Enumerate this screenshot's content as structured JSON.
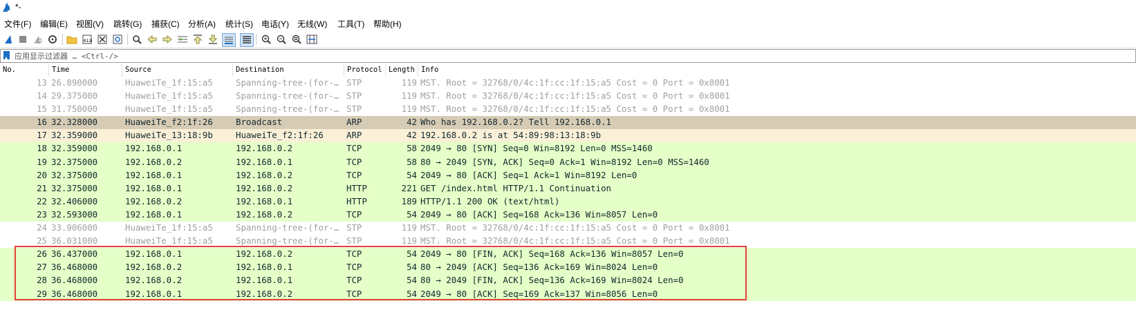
{
  "window": {
    "title": "*-"
  },
  "menu": [
    "文件(F)",
    "编辑(E)",
    "视图(V)",
    "跳转(G)",
    "捕获(C)",
    "分析(A)",
    "统计(S)",
    "电话(Y)",
    "无线(W)",
    "工具(T)",
    "帮助(H)"
  ],
  "toolbar_icons": [
    "shark-fin-start-icon",
    "stop-icon",
    "restart-icon",
    "options-gear-icon",
    "open-folder-icon",
    "save-file-icon",
    "close-file-icon",
    "reload-icon",
    "find-icon",
    "back-arrow-icon",
    "forward-arrow-icon",
    "go-to-packet-icon",
    "first-packet-icon",
    "last-packet-icon",
    "autoscroll-icon",
    "colorize-icon",
    "zoom-in-icon",
    "zoom-out-icon",
    "normal-size-icon",
    "resize-columns-icon"
  ],
  "filter": {
    "placeholder": "应用显示过滤器 … <Ctrl-/>"
  },
  "columns": {
    "no": "No.",
    "time": "Time",
    "source": "Source",
    "destination": "Destination",
    "protocol": "Protocol",
    "length": "Length",
    "info": "Info"
  },
  "packets": [
    {
      "no": "13",
      "time": "26.890000",
      "src": "HuaweiTe_1f:15:a5",
      "dst": "Spanning-tree-(for-…",
      "proto": "STP",
      "len": "119",
      "info": "MST. Root = 32768/0/4c:1f:cc:1f:15:a5  Cost = 0  Port = 0x8001",
      "style": "stp"
    },
    {
      "no": "14",
      "time": "29.375000",
      "src": "HuaweiTe_1f:15:a5",
      "dst": "Spanning-tree-(for-…",
      "proto": "STP",
      "len": "119",
      "info": "MST. Root = 32768/0/4c:1f:cc:1f:15:a5  Cost = 0  Port = 0x8001",
      "style": "stp"
    },
    {
      "no": "15",
      "time": "31.750000",
      "src": "HuaweiTe_1f:15:a5",
      "dst": "Spanning-tree-(for-…",
      "proto": "STP",
      "len": "119",
      "info": "MST. Root = 32768/0/4c:1f:cc:1f:15:a5  Cost = 0  Port = 0x8001",
      "style": "stp"
    },
    {
      "no": "16",
      "time": "32.328000",
      "src": "HuaweiTe_f2:1f:26",
      "dst": "Broadcast",
      "proto": "ARP",
      "len": "42",
      "info": "Who has 192.168.0.2? Tell 192.168.0.1",
      "style": "arp1"
    },
    {
      "no": "17",
      "time": "32.359000",
      "src": "HuaweiTe_13:18:9b",
      "dst": "HuaweiTe_f2:1f:26",
      "proto": "ARP",
      "len": "42",
      "info": "192.168.0.2 is at 54:89:98:13:18:9b",
      "style": "arp2"
    },
    {
      "no": "18",
      "time": "32.359000",
      "src": "192.168.0.1",
      "dst": "192.168.0.2",
      "proto": "TCP",
      "len": "58",
      "info": "2049 → 80 [SYN] Seq=0 Win=8192 Len=0 MSS=1460",
      "style": "tcp"
    },
    {
      "no": "19",
      "time": "32.375000",
      "src": "192.168.0.2",
      "dst": "192.168.0.1",
      "proto": "TCP",
      "len": "58",
      "info": "80 → 2049 [SYN, ACK] Seq=0 Ack=1 Win=8192 Len=0 MSS=1460",
      "style": "tcp"
    },
    {
      "no": "20",
      "time": "32.375000",
      "src": "192.168.0.1",
      "dst": "192.168.0.2",
      "proto": "TCP",
      "len": "54",
      "info": "2049 → 80 [ACK] Seq=1 Ack=1 Win=8192 Len=0",
      "style": "tcp"
    },
    {
      "no": "21",
      "time": "32.375000",
      "src": "192.168.0.1",
      "dst": "192.168.0.2",
      "proto": "HTTP",
      "len": "221",
      "info": "GET /index.html HTTP/1.1 Continuation",
      "style": "tcp"
    },
    {
      "no": "22",
      "time": "32.406000",
      "src": "192.168.0.2",
      "dst": "192.168.0.1",
      "proto": "HTTP",
      "len": "189",
      "info": "HTTP/1.1 200 OK  (text/html)",
      "style": "tcp"
    },
    {
      "no": "23",
      "time": "32.593000",
      "src": "192.168.0.1",
      "dst": "192.168.0.2",
      "proto": "TCP",
      "len": "54",
      "info": "2049 → 80 [ACK] Seq=168 Ack=136 Win=8057 Len=0",
      "style": "tcp"
    },
    {
      "no": "24",
      "time": "33.906000",
      "src": "HuaweiTe_1f:15:a5",
      "dst": "Spanning-tree-(for-…",
      "proto": "STP",
      "len": "119",
      "info": "MST. Root = 32768/0/4c:1f:cc:1f:15:a5  Cost = 0  Port = 0x8001",
      "style": "stp"
    },
    {
      "no": "25",
      "time": "36.031000",
      "src": "HuaweiTe_1f:15:a5",
      "dst": "Spanning-tree-(for-…",
      "proto": "STP",
      "len": "119",
      "info": "MST. Root = 32768/0/4c:1f:cc:1f:15:a5  Cost = 0  Port = 0x8001",
      "style": "stp"
    },
    {
      "no": "26",
      "time": "36.437000",
      "src": "192.168.0.1",
      "dst": "192.168.0.2",
      "proto": "TCP",
      "len": "54",
      "info": "2049 → 80 [FIN, ACK] Seq=168 Ack=136 Win=8057 Len=0",
      "style": "tcp"
    },
    {
      "no": "27",
      "time": "36.468000",
      "src": "192.168.0.2",
      "dst": "192.168.0.1",
      "proto": "TCP",
      "len": "54",
      "info": "80 → 2049 [ACK] Seq=136 Ack=169 Win=8024 Len=0",
      "style": "tcp"
    },
    {
      "no": "28",
      "time": "36.468000",
      "src": "192.168.0.2",
      "dst": "192.168.0.1",
      "proto": "TCP",
      "len": "54",
      "info": "80 → 2049 [FIN, ACK] Seq=136 Ack=169 Win=8024 Len=0",
      "style": "tcp"
    },
    {
      "no": "29",
      "time": "36.468000",
      "src": "192.168.0.1",
      "dst": "192.168.0.2",
      "proto": "TCP",
      "len": "54",
      "info": "2049 → 80 [ACK] Seq=169 Ack=137 Win=8056 Len=0",
      "style": "tcp"
    }
  ],
  "colors": {
    "tcp_row": "#e4ffc7",
    "arp_request_row": "#d6cbb4",
    "arp_reply_row": "#faf0d7",
    "stp_text": "#a0a0a0",
    "annotation_box": "#e0403a"
  }
}
